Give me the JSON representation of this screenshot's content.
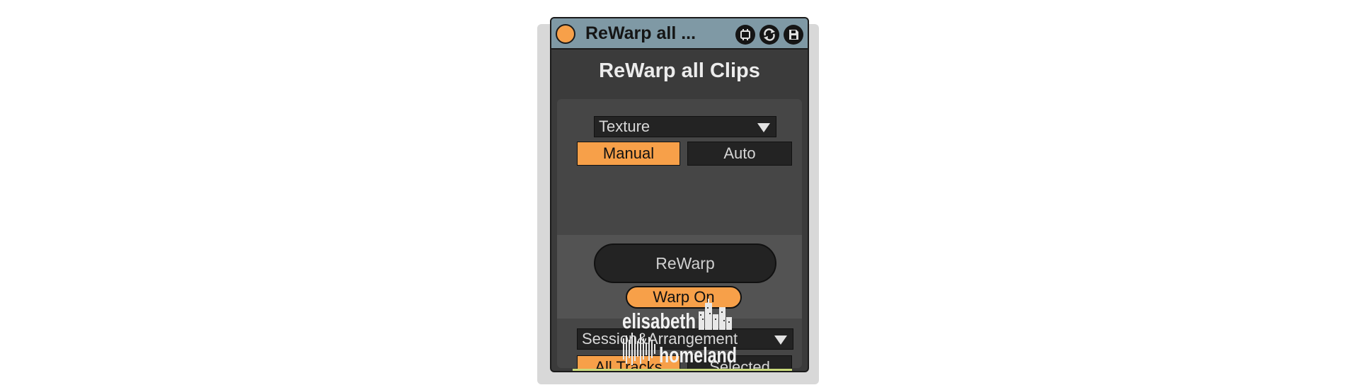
{
  "window": {
    "title": "ReWarp all ...",
    "buttons": [
      "lock-icon",
      "refresh-icon",
      "save-icon"
    ]
  },
  "device": {
    "heading": "ReWarp all Clips",
    "algorithm": {
      "selected": "Texture"
    },
    "mode_tabs": [
      {
        "label": "Manual",
        "active": true
      },
      {
        "label": "Auto",
        "active": false
      }
    ],
    "rewarp_button": "ReWarp",
    "warp_toggle": {
      "label": "Warp On",
      "on": true
    },
    "scope": {
      "selected": "Session&Arrangement"
    },
    "track_tabs": [
      {
        "label": "All Tracks",
        "active": true
      },
      {
        "label": "Selected",
        "active": false
      }
    ],
    "logo": {
      "line1": "elisabeth",
      "line2": "homeland"
    }
  },
  "colors": {
    "accent": "#f7a049",
    "titlebar": "#7f99a5",
    "background": "#3b3b3b",
    "control": "#232323"
  }
}
